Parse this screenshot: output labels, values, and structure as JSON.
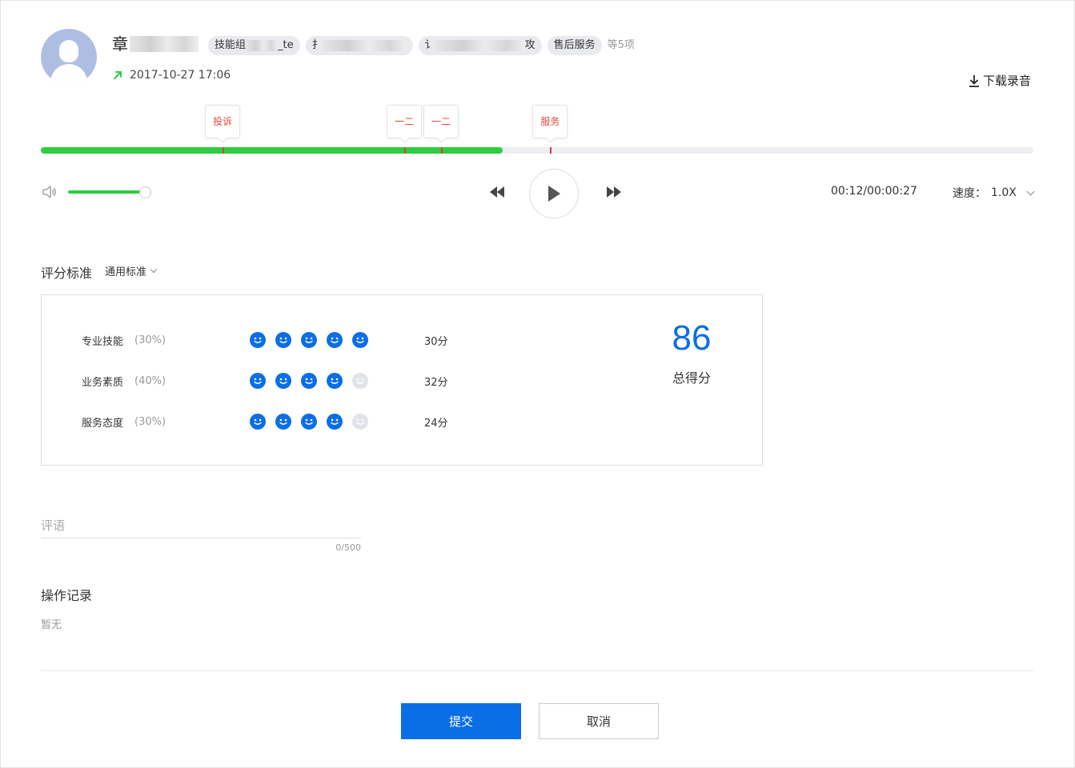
{
  "header": {
    "name_visible": "章",
    "tags": [
      {
        "prefix": "技能组",
        "suffix": "_te"
      },
      {
        "prefix": "扌",
        "suffix": ""
      },
      {
        "prefix": "讠",
        "suffix": "攻"
      },
      {
        "prefix": "售后服务",
        "suffix": ""
      }
    ],
    "more_tags": "等5项",
    "datetime": "2017-10-27 17:06",
    "download_label": "下载录音"
  },
  "timeline": {
    "progress": 0.465,
    "markers": [
      {
        "label": "投诉",
        "position": 0.184
      },
      {
        "label": "一二",
        "position": 0.367
      },
      {
        "label": "一二",
        "position": 0.404
      },
      {
        "label": "服务",
        "position": 0.514
      }
    ]
  },
  "player": {
    "volume": 0.92,
    "current_time": "00:12",
    "total_time": "00:00:27",
    "time_separator": "/",
    "speed_label": "速度：",
    "speed_value": "1.0X"
  },
  "scoring": {
    "standard_label": "评分标准",
    "standard_value": "通用标准",
    "criteria": [
      {
        "label": "专业技能",
        "weight": "(30%)",
        "rating": 5,
        "max": 5,
        "score": "30分"
      },
      {
        "label": "业务素质",
        "weight": "(40%)",
        "rating": 4,
        "max": 5,
        "score": "32分"
      },
      {
        "label": "服务态度",
        "weight": "(30%)",
        "rating": 4,
        "max": 5,
        "score": "24分"
      }
    ],
    "total": "86",
    "total_label": "总得分"
  },
  "comment": {
    "placeholder": "评语",
    "value": "",
    "counter": "0/500"
  },
  "log": {
    "title": "操作记录",
    "empty": "暂无"
  },
  "actions": {
    "submit": "提交",
    "cancel": "取消"
  },
  "colors": {
    "accent": "#0a6ee6",
    "progress": "#2ecc40",
    "marker": "#e04a3a"
  }
}
